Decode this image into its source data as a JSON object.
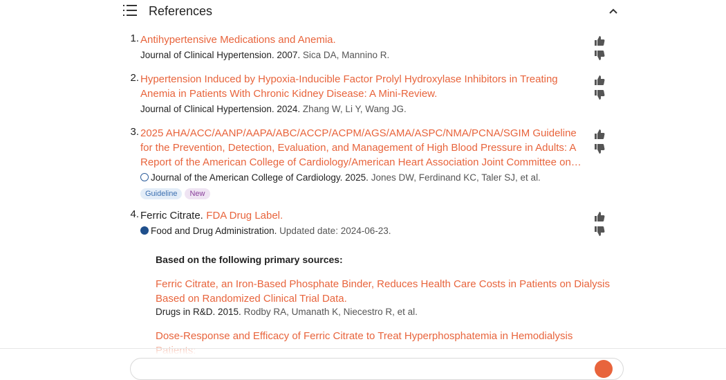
{
  "header": {
    "title": "References",
    "list_icon": "list-icon",
    "collapse_icon": "chevron-up-icon"
  },
  "references": [
    {
      "number": "1.",
      "title": "Antihypertensive Medications and Anemia.",
      "journal": "Journal of Clinical Hypertension. 2007.",
      "authors": "Sica DA, Mannino R."
    },
    {
      "number": "2.",
      "title": "Hypertension Induced by Hypoxia-Inducible Factor Prolyl Hydroxylase Inhibitors in Treating Anemia in Patients With Chronic Kidney Disease: A Mini-Review.",
      "journal": "Journal of Clinical Hypertension. 2024.",
      "authors": "Zhang W, Li Y, Wang JG."
    },
    {
      "number": "3.",
      "title": "2025 AHA/ACC/AANP/AAPA/ABC/ACCP/ACPM/AGS/AMA/ASPC/NMA/PCNA/SGIM Guideline for the Prevention, Detection, Evaluation, and Management of High Blood Pressure in Adults: A Report of the American College of Cardiology/American Heart Association Joint Committee on…",
      "journal": "Journal of the American College of Cardiology. 2025.",
      "authors": "Jones DW, Ferdinand KC, Taler SJ, et al.",
      "badges": [
        "Guideline",
        "New"
      ]
    },
    {
      "number": "4.",
      "plain_prefix": "Ferric Citrate.",
      "title": "FDA Drug Label.",
      "journal": "Food and Drug Administration.",
      "authors": "Updated date: 2024-06-23."
    }
  ],
  "primary_sources": {
    "heading": "Based on the following primary sources:",
    "items": [
      {
        "title": "Ferric Citrate, an Iron-Based Phosphate Binder, Reduces Health Care Costs in Patients on Dialysis Based on Randomized Clinical Trial Data.",
        "journal": "Drugs in R&D. 2015.",
        "authors": "Rodby RA, Umanath K, Niecestro R, et al."
      },
      {
        "title": "Dose-Response and Efficacy of Ferric Citrate to Treat Hyperphosphatemia in Hemodialysis Patients:",
        "journal": "",
        "authors": ""
      }
    ]
  },
  "colors": {
    "link": "#e8643c",
    "text": "#222222",
    "muted": "#555555",
    "guideline_bg": "#e3edf8",
    "new_bg": "#efe4f3"
  }
}
